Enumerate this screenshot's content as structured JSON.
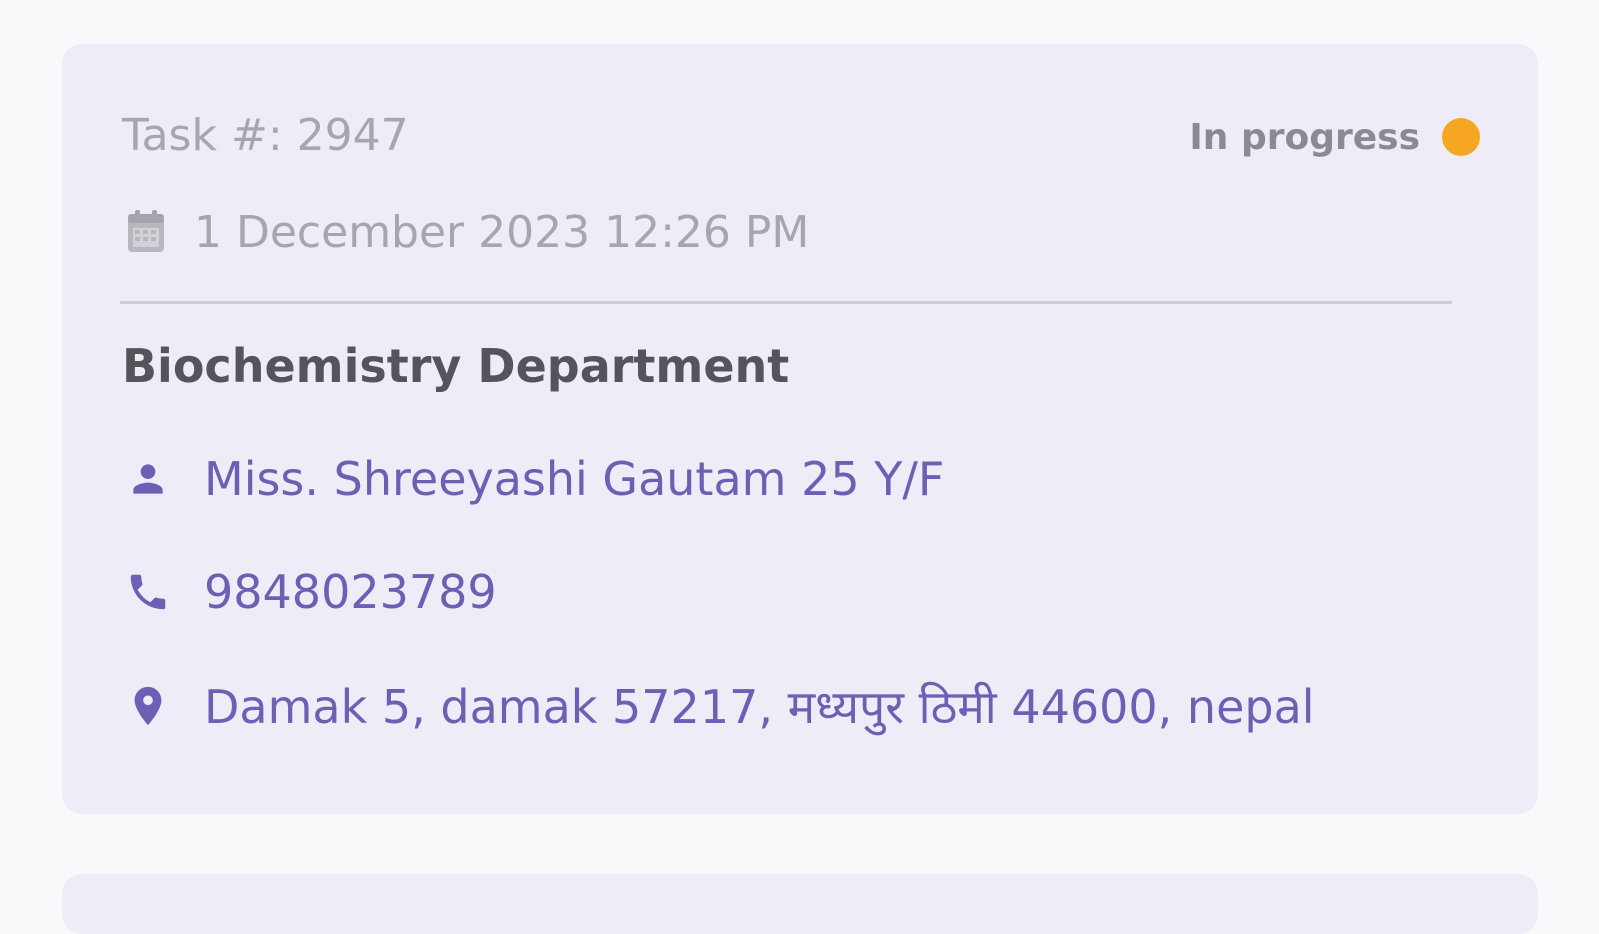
{
  "task": {
    "id_label": "Task #: 2947",
    "status_label": "In progress",
    "date_text": "1 December 2023 12:26 PM",
    "department": "Biochemistry Department",
    "patient": "Miss. Shreeyashi Gautam  25 Y/F",
    "phone": "9848023789",
    "address": "Damak 5, damak 57217, मध्यपुर ठिमी 44600, nepal"
  },
  "icons": {
    "date": "calendar-icon",
    "patient": "person-icon",
    "phone": "phone-icon",
    "address": "location-pin-icon"
  },
  "colors": {
    "background": "#f9f9fb",
    "card": "#eeecf6",
    "accent": "#6d5fb4",
    "status_in_progress": "#f6a623",
    "muted_text": "#a7a6ad",
    "heading_text": "#55545a"
  }
}
